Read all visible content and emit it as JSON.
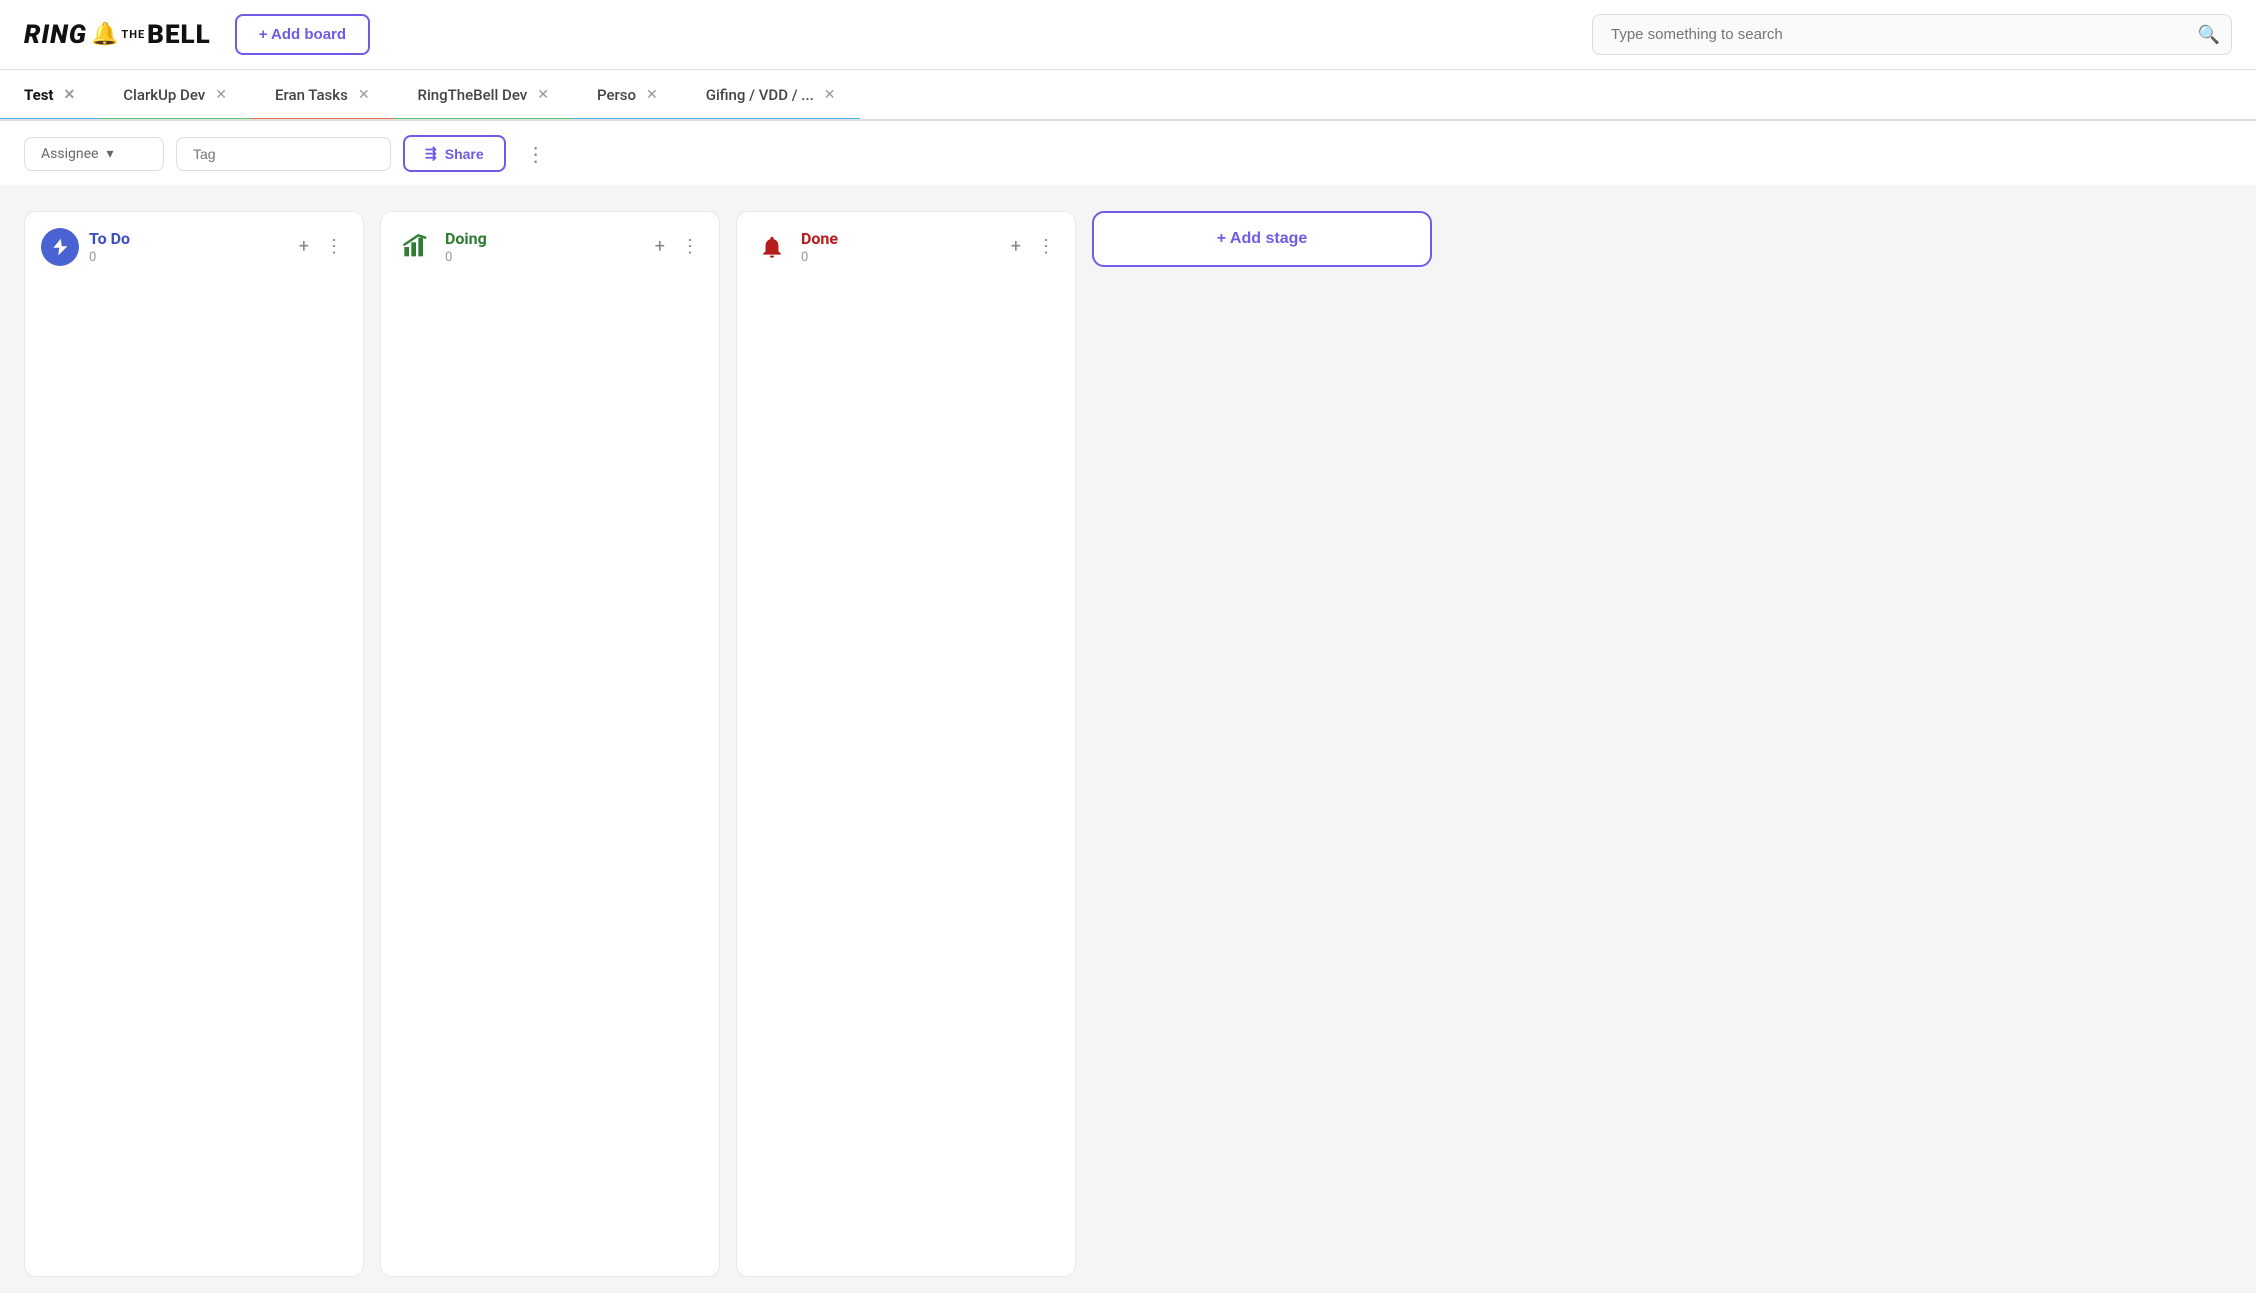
{
  "header": {
    "logo": {
      "ring": "RING",
      "the": "the",
      "bell": "BELL",
      "bell_icon": "🔔"
    },
    "add_board_label": "+ Add board",
    "search_placeholder": "Type something to search"
  },
  "tabs": [
    {
      "id": "test",
      "label": "Test",
      "active": true
    },
    {
      "id": "clarkup",
      "label": "ClarkUp Dev",
      "active": false
    },
    {
      "id": "eran",
      "label": "Eran Tasks",
      "active": false
    },
    {
      "id": "ringthebell",
      "label": "RingTheBell Dev",
      "active": false
    },
    {
      "id": "perso",
      "label": "Perso",
      "active": false
    },
    {
      "id": "gifing",
      "label": "Gifing / VDD / ...",
      "active": false
    }
  ],
  "toolbar": {
    "assignee_label": "Assignee",
    "tag_placeholder": "Tag",
    "share_label": "Share"
  },
  "columns": [
    {
      "id": "todo",
      "title": "To Do",
      "count": "0",
      "icon": "bolt",
      "color_class": "col-todo"
    },
    {
      "id": "doing",
      "title": "Doing",
      "count": "0",
      "icon": "chart",
      "color_class": "col-doing"
    },
    {
      "id": "done",
      "title": "Done",
      "count": "0",
      "icon": "bell",
      "color_class": "col-done"
    }
  ],
  "add_stage_label": "+ Add stage"
}
